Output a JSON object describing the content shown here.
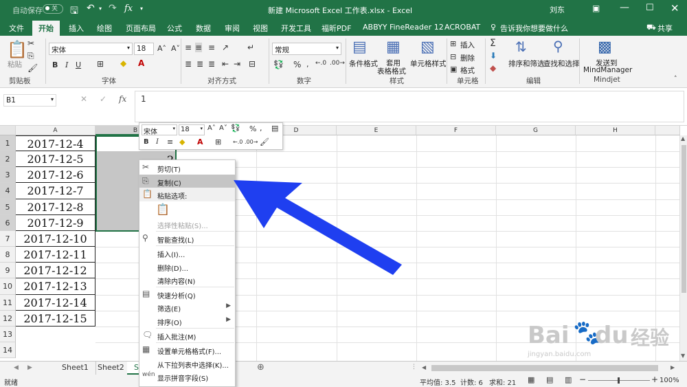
{
  "title_bar": {
    "autosave_label": "自动保存",
    "autosave_state": "关",
    "document_title": "新建 Microsoft Excel 工作表.xlsx - Excel",
    "user_name": "刘东"
  },
  "tabs": [
    "文件",
    "开始",
    "插入",
    "绘图",
    "页面布局",
    "公式",
    "数据",
    "审阅",
    "视图",
    "开发工具",
    "福昕PDF",
    "ABBYY FineReader 12",
    "ACROBAT"
  ],
  "tell_me": "告诉我你想要做什么",
  "share": "共享",
  "ribbon": {
    "clipboard": {
      "paste": "粘贴",
      "group": "剪贴板"
    },
    "font": {
      "name": "宋体",
      "size": "18",
      "group": "字体"
    },
    "alignment": {
      "group": "对齐方式"
    },
    "number": {
      "format": "常规",
      "group": "数字"
    },
    "styles": {
      "cond_format": "条件格式",
      "table_format_1": "套用",
      "table_format_2": "表格格式",
      "cell_styles": "单元格样式",
      "group": "样式"
    },
    "cells": {
      "insert": "插入",
      "delete": "删除",
      "format": "格式",
      "group": "单元格"
    },
    "editing": {
      "sort_filter": "排序和筛选",
      "find_select": "查找和选择",
      "group": "编辑"
    },
    "mindjet": {
      "send_1": "发送到",
      "send_2": "MindManager",
      "group": "Mindjet"
    }
  },
  "formula_bar": {
    "name_box": "B1",
    "fx": "fx",
    "value": "1"
  },
  "columns": [
    "A",
    "B",
    "C",
    "D",
    "E",
    "F",
    "G",
    "H"
  ],
  "rows": [
    "1",
    "2",
    "3",
    "4",
    "5",
    "6",
    "7",
    "8",
    "9",
    "10",
    "11",
    "12",
    "13",
    "14"
  ],
  "cells_a": [
    "2017-12-4",
    "2017-12-5",
    "2017-12-6",
    "2017-12-7",
    "2017-12-8",
    "2017-12-9",
    "2017-12-10",
    "2017-12-11",
    "2017-12-12",
    "2017-12-13",
    "2017-12-14",
    "2017-12-15"
  ],
  "cell_b2_partial": "2",
  "mini_toolbar": {
    "font": "宋体",
    "size": "18"
  },
  "context_menu": {
    "cut": "剪切(T)",
    "copy": "复制(C)",
    "paste_options": "粘贴选项:",
    "paste_special": "选择性粘贴(S)...",
    "smart_lookup": "智能查找(L)",
    "insert": "插入(I)...",
    "delete": "删除(D)...",
    "clear": "清除内容(N)",
    "quick_analysis": "快速分析(Q)",
    "filter": "筛选(E)",
    "sort": "排序(O)",
    "insert_comment": "插入批注(M)",
    "format_cells": "设置单元格格式(F)...",
    "pick_list": "从下拉列表中选择(K)...",
    "phonetic": "显示拼音字段(S)"
  },
  "sheet_tabs": [
    "Sheet1",
    "Sheet2",
    "S"
  ],
  "status": {
    "mode": "就绪",
    "average": "平均值: 3.5",
    "count": "计数: 6",
    "sum": "求和: 21",
    "zoom": "100%"
  },
  "watermark": {
    "text_1": "Bai",
    "text_2": "du",
    "text_3": "经验",
    "url": "jingyan.baidu.com"
  },
  "colors": {
    "excel_green": "#217346",
    "arrow": "#1f3ff0",
    "selection": "#c6c6c6"
  }
}
